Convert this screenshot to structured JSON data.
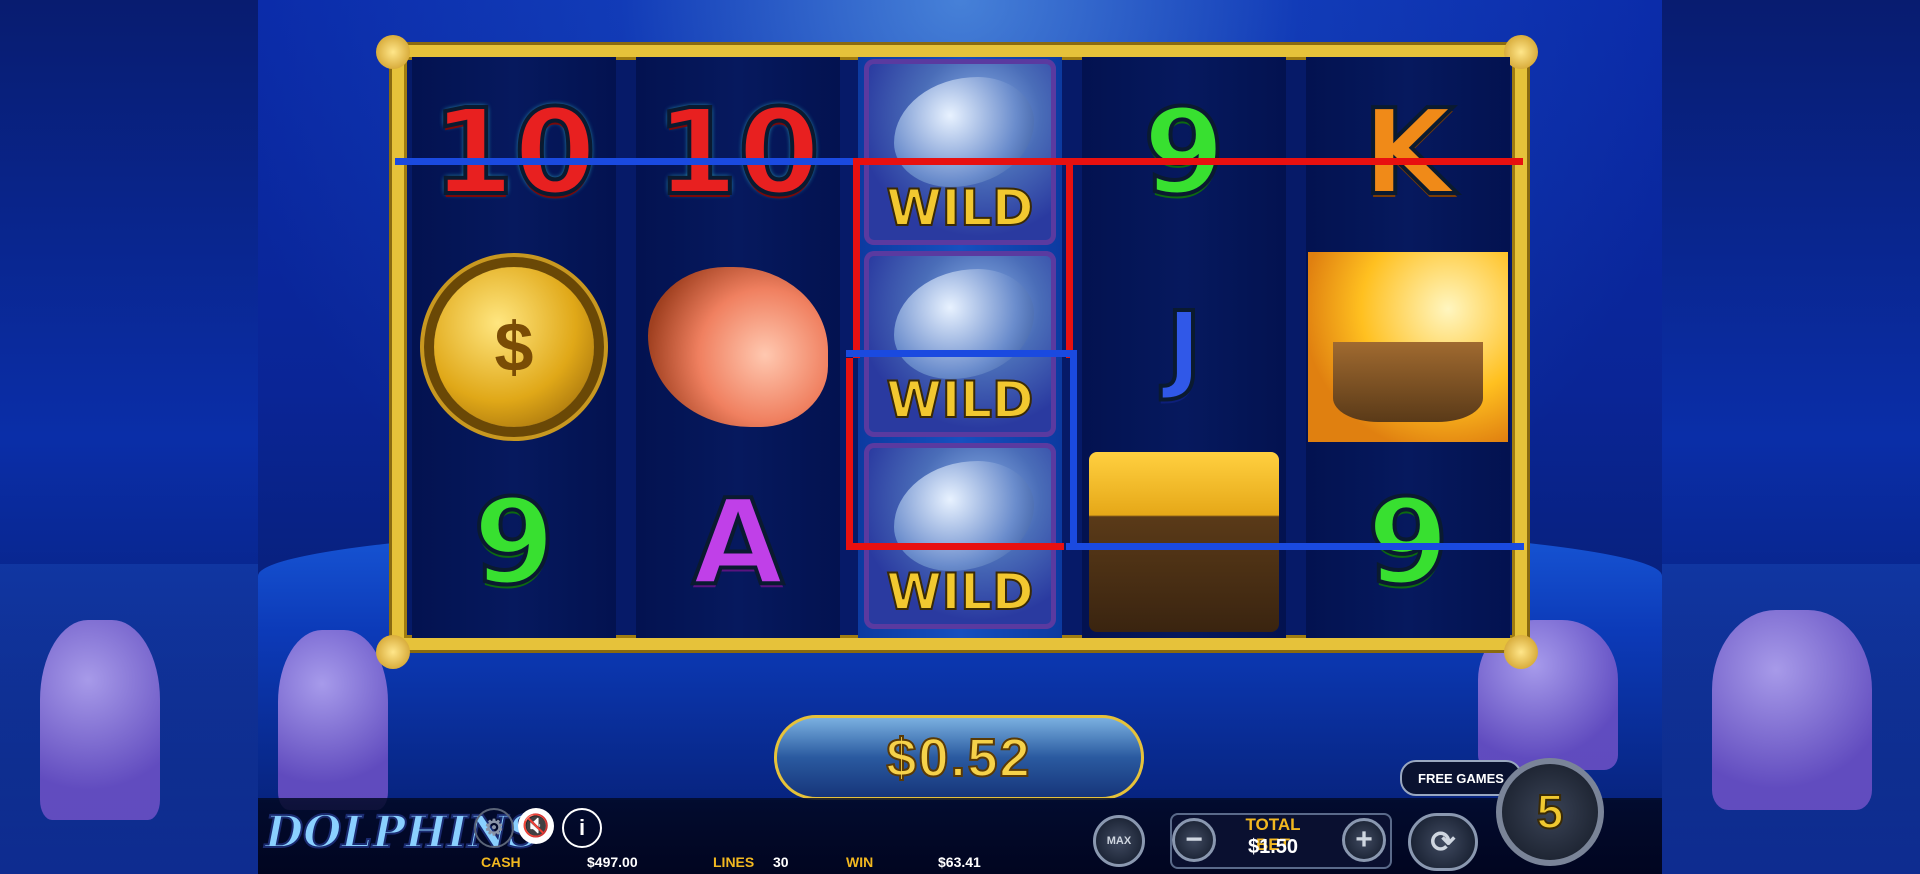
{
  "game": {
    "logo_text": "DOLPHINS",
    "win_display": "$0.52"
  },
  "reels": [
    [
      "10",
      "coin-icon",
      "9"
    ],
    [
      "10",
      "conch-shell-icon",
      "A"
    ],
    [
      "WILD",
      "WILD",
      "WILD"
    ],
    [
      "9",
      "J",
      "treasure-chest-icon"
    ],
    [
      "K",
      "ship-icon",
      "9"
    ]
  ],
  "wild_label": "WILD",
  "bottom_bar": {
    "cash_label": "CASH",
    "cash_value": "$497.00",
    "lines_label": "LINES",
    "lines_value": "30",
    "win_label": "WIN",
    "win_value": "$63.41",
    "max_label": "MAX",
    "total_bet_label": "TOTAL BET",
    "total_bet_value": "$1.50",
    "free_games_label": "FREE GAMES",
    "free_games_count": "5"
  },
  "colors": {
    "frame_gold": "#e6c23a",
    "payline_red": "#e81010",
    "payline_blue": "#1a4ae0",
    "label_gold": "#f2b820"
  }
}
